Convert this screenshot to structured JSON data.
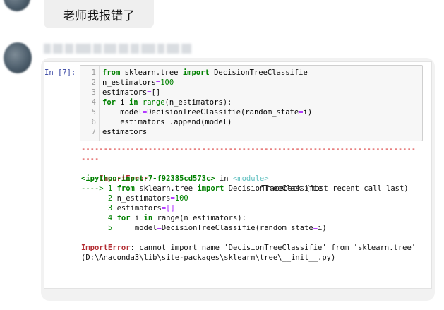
{
  "chat": {
    "top_message": "老师我报错了"
  },
  "notebook": {
    "in_prompt": "In  [7]:",
    "code_lines": [
      {
        "num": "1",
        "parts": [
          {
            "t": "from",
            "c": "kw"
          },
          {
            "t": " sklearn.tree ",
            "c": ""
          },
          {
            "t": "import",
            "c": "kw"
          },
          {
            "t": " DecisionTreeClassifie",
            "c": ""
          }
        ]
      },
      {
        "num": "2",
        "parts": [
          {
            "t": "n_estimators",
            "c": ""
          },
          {
            "t": "=",
            "c": "op"
          },
          {
            "t": "100",
            "c": "num"
          }
        ]
      },
      {
        "num": "3",
        "parts": [
          {
            "t": "estimators",
            "c": ""
          },
          {
            "t": "=",
            "c": "op"
          },
          {
            "t": "[]",
            "c": ""
          }
        ]
      },
      {
        "num": "4",
        "parts": [
          {
            "t": "for",
            "c": "kw"
          },
          {
            "t": " i ",
            "c": ""
          },
          {
            "t": "in",
            "c": "kw"
          },
          {
            "t": " ",
            "c": ""
          },
          {
            "t": "range",
            "c": "bi"
          },
          {
            "t": "(n_estimators):",
            "c": ""
          }
        ]
      },
      {
        "num": "5",
        "parts": [
          {
            "t": "    model",
            "c": ""
          },
          {
            "t": "=",
            "c": "op"
          },
          {
            "t": "DecisionTreeClassifie(random_state",
            "c": ""
          },
          {
            "t": "=",
            "c": "op"
          },
          {
            "t": "i)",
            "c": ""
          }
        ]
      },
      {
        "num": "6",
        "parts": [
          {
            "t": "    estimators_.append(model)",
            "c": ""
          }
        ]
      },
      {
        "num": "7",
        "parts": [
          {
            "t": "estimators_",
            "c": ""
          }
        ]
      }
    ],
    "traceback": {
      "dashes_line1": "---------------------------------------------------------------------------",
      "dashes_line2": "----",
      "error_name": "ImportError",
      "traceback_label": "Traceback (most recent call last)",
      "ipython_input": "<ipython-input-7-f92385cd573c>",
      "in_word": " in ",
      "module": "<module>",
      "arrow": "----> 1 ",
      "tb_lines": [
        {
          "prefix": "----> 1 ",
          "parts": [
            {
              "t": "from",
              "c": "kw"
            },
            {
              "t": " sklearn.tree ",
              "c": ""
            },
            {
              "t": "import",
              "c": "kw"
            },
            {
              "t": " DecisionTreeClassifie",
              "c": ""
            }
          ]
        },
        {
          "prefix": "      2 ",
          "parts": [
            {
              "t": "n_estimators",
              "c": ""
            },
            {
              "t": "=",
              "c": "op"
            },
            {
              "t": "100",
              "c": "num"
            }
          ]
        },
        {
          "prefix": "      3 ",
          "parts": [
            {
              "t": "estimators",
              "c": ""
            },
            {
              "t": "=",
              "c": "op"
            },
            {
              "t": "[]",
              "c": "op"
            }
          ]
        },
        {
          "prefix": "      4 ",
          "parts": [
            {
              "t": "for",
              "c": "kw"
            },
            {
              "t": " i ",
              "c": ""
            },
            {
              "t": "in",
              "c": "kw"
            },
            {
              "t": " range(n_estimators):",
              "c": ""
            }
          ]
        },
        {
          "prefix": "      5 ",
          "parts": [
            {
              "t": "    model",
              "c": ""
            },
            {
              "t": "=",
              "c": "op"
            },
            {
              "t": "DecisionTreeClassifie(random_state",
              "c": ""
            },
            {
              "t": "=",
              "c": "op"
            },
            {
              "t": "i)",
              "c": ""
            }
          ]
        }
      ],
      "final_error_name": "ImportError",
      "final_message": ": cannot import name 'DecisionTreeClassifie' from 'sklearn.tree'",
      "final_path": "(D:\\Anaconda3\\lib\\site-packages\\sklearn\\tree\\__init__.py)"
    }
  },
  "colors": {
    "keyword": "#008000",
    "operator": "#aa22ff",
    "error_red": "#d00000",
    "prompt_blue": "#303f9f",
    "bubble_bg": "#f2f2f2"
  }
}
